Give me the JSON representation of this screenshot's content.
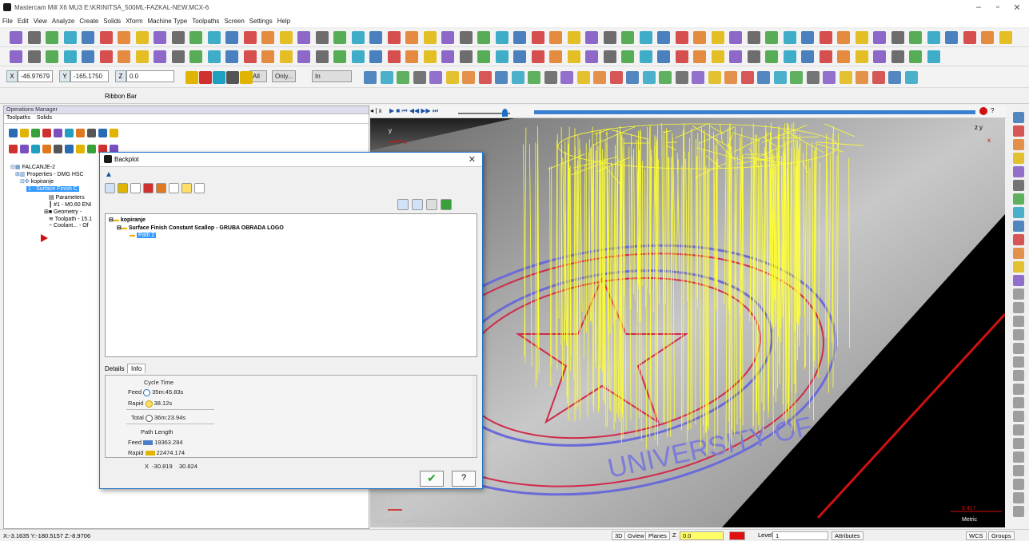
{
  "window": {
    "title": "Mastercam Mill X6 MU3  E:\\KRINITSA_500ML-FAZKAL-NEW.MCX-6"
  },
  "menu": [
    "File",
    "Edit",
    "View",
    "Analyze",
    "Create",
    "Solids",
    "Xform",
    "Machine Type",
    "Toolpaths",
    "Screen",
    "Settings",
    "Help"
  ],
  "coords_toolbar": {
    "x_value": "-46.97679",
    "y_value": "-165.1750",
    "z_value": "0.0",
    "only_label": "Only...",
    "in_label": "In"
  },
  "ribbon": {
    "label": "Ribbon Bar"
  },
  "ops_manager": {
    "title": "Operations Manager",
    "tabs": [
      "Toolpaths",
      "Solids"
    ],
    "tree": [
      "FALCANJE-2",
      "Properties - DMG HSC",
      "kopiranje",
      "1 - Surface Finish C",
      "Parameters",
      "#1 - M0.60 ENI",
      "Geometry -",
      "Toolpath - 15.1",
      "Coolant... - Of"
    ]
  },
  "backplot": {
    "title": "Backplot",
    "tree": {
      "group": "kopiranje",
      "operation": "Surface Finish Constant Scallop - GRUBA OBRADA LOGO",
      "path": "Path 2"
    },
    "tabs": [
      "Details",
      "Info"
    ],
    "info": {
      "cycle_time_label": "Cycle Time",
      "feed_label": "Feed",
      "feed_time": "35m:45.83s",
      "rapid_label": "Rapid",
      "rapid_time": "38.12s",
      "total_label": "Total",
      "total_time": "36m:23.94s",
      "path_length_label": "Path Length",
      "feed_length": "19363.284",
      "rapid_length": "22474.174",
      "x_label": "X",
      "x_val1": "-30.819",
      "x_val2": "30.824"
    }
  },
  "viewport": {
    "gview_text": "Gview:Not Saved   WCS:TOP   T/Cplane:TOP",
    "scale_value": "8.417",
    "scale_unit": "Metric",
    "axis_x": "x",
    "axis_y": "y",
    "axis_z": "z"
  },
  "statusbar": {
    "coords": "X:-3.1635  Y:-180.5157  Z:-8.9706",
    "btn_3d": "3D",
    "btn_gview": "Gview",
    "btn_planes": "Planes",
    "z_label": "Z",
    "z_value": "0.0",
    "level_label": "Level",
    "level_value": "1",
    "attributes_label": "Attributes",
    "wcs_label": "WCS",
    "groups_label": "Groups"
  },
  "colors": {
    "toolpath": "#ffff33",
    "accent": "#1a6fc7",
    "status_red": "#e01010"
  }
}
